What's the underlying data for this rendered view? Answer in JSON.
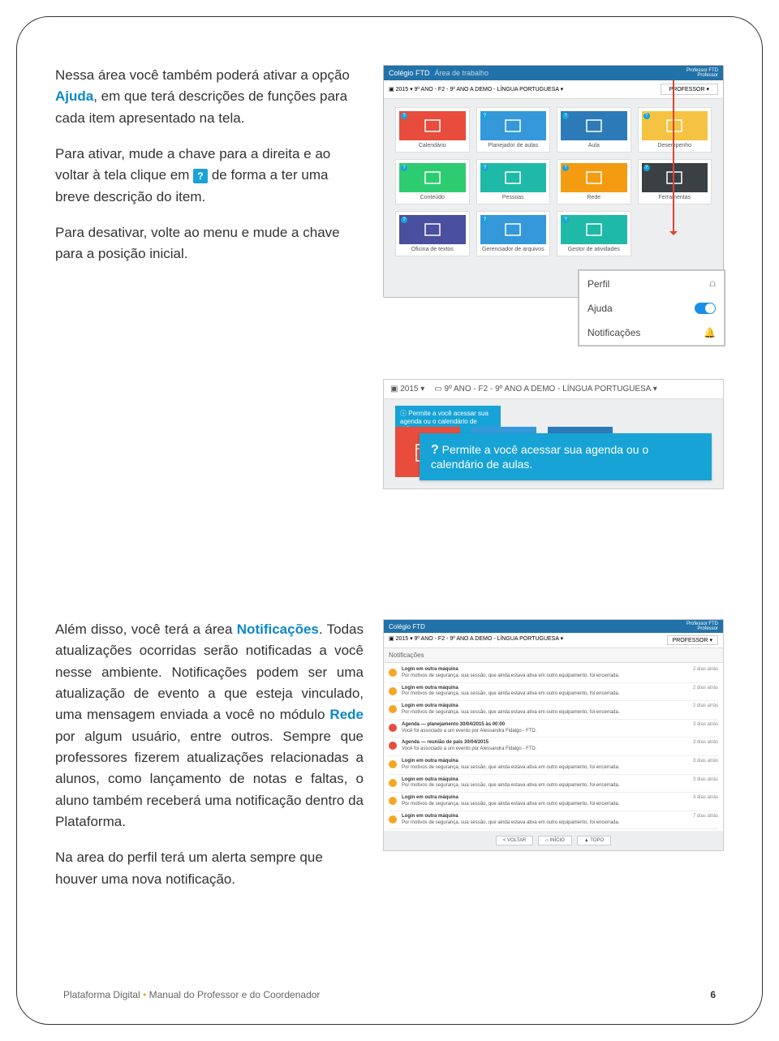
{
  "text": {
    "p1a": "Nessa área você também poderá ativar a opção ",
    "p1_link": "Ajuda",
    "p1b": ", em que terá descrições de funções para cada item apresentado na tela.",
    "p2a": "Para ativar, mude a chave para a direita e ao voltar à tela clique em ",
    "p2b": " de forma a ter uma breve descrição do item.",
    "p3": "Para desativar, volte ao menu e mude a chave para a posição inicial.",
    "p4a": "Além disso, você terá a área ",
    "p4_link": "Notificações",
    "p4b": ". Todas atualizações ocorridas serão notificadas a você nesse ambiente. Notificações podem ser uma atualização de evento a que esteja vinculado, uma mensagem enviada a você no módulo ",
    "p4_link2": "Rede",
    "p4c": " por algum usuário, entre outros. Sempre que professores fizerem atualizações relacionadas a alunos, como lançamento de notas e faltas, o aluno também receberá uma notificação dentro da Plataforma.",
    "p5": "Na area do perfil terá um alerta sempre que houver uma nova notificação."
  },
  "shot1": {
    "brand": "Colégio FTD",
    "area": "Área de trabalho",
    "breadcrumb": "2015  ▾   9º ANO - F2 - 9º ANO A DEMO - LÍNGUA PORTUGUESA ▾",
    "prof_name": "Professor FTD\nProfessor",
    "prof_btn": "PROFESSOR ▾",
    "tiles": [
      {
        "label": "Calendário",
        "color": "c-red"
      },
      {
        "label": "Planejador de aulas",
        "color": "c-blue"
      },
      {
        "label": "Aula",
        "color": "c-blue2"
      },
      {
        "label": "Desempenho",
        "color": "c-yellow"
      },
      {
        "label": "Conteúdo",
        "color": "c-green"
      },
      {
        "label": "Pessoas",
        "color": "c-teal"
      },
      {
        "label": "Rede",
        "color": "c-orange"
      },
      {
        "label": "Ferramentas",
        "color": "c-dark"
      },
      {
        "label": "Oficina de textos",
        "color": "c-indigo"
      },
      {
        "label": "Gerenciador de arquivos",
        "color": "c-blue"
      },
      {
        "label": "Gestor de atividades",
        "color": "c-teal"
      }
    ],
    "popup": {
      "perfil": "Perfil",
      "ajuda": "Ajuda",
      "notif": "Notificações"
    }
  },
  "shot2": {
    "year": "2015 ▾",
    "breadcrumb": "9º ANO - F2 - 9º ANO A DEMO - LÍNGUA PORTUGUESA ▾",
    "small_tip": "Permite a você acessar sua agenda ou o calendário de aulas.",
    "tooltip_q": "?",
    "tooltip": "Permite a você acessar sua agenda ou o calendário de aulas."
  },
  "shot3": {
    "brand": "Colégio FTD",
    "breadcrumb": "2015 ▾   9º ANO - F2 - 9º ANO A DEMO - LÍNGUA PORTUGUESA ▾",
    "prof_btn": "PROFESSOR ▾",
    "prof_name": "Professor FTD\nProfessor",
    "title": "Notificações",
    "rows": [
      {
        "c": "d-or",
        "t": "Login em outra máquina",
        "d": "Por motivos de segurança, sua sessão, que ainda estava ativa em outro equipamento, foi encerrada.",
        "tm": "2 dias atrás"
      },
      {
        "c": "d-or",
        "t": "Login em outra máquina",
        "d": "Por motivos de segurança, sua sessão, que ainda estava ativa em outro equipamento, foi encerrada.",
        "tm": "2 dias atrás"
      },
      {
        "c": "d-or",
        "t": "Login em outra máquina",
        "d": "Por motivos de segurança, sua sessão, que ainda estava ativa em outro equipamento, foi encerrada.",
        "tm": "2 dias atrás"
      },
      {
        "c": "d-rd",
        "t": "Agenda — planejamento 30/04/2015 às 00:00",
        "d": "Você foi associado a um evento por Alessandra Fidalgo - FTD.",
        "tm": "3 dias atrás"
      },
      {
        "c": "d-rd",
        "t": "Agenda — reunião de pais 30/04/2015",
        "d": "Você foi associado a um evento por Alessandra Fidalgo - FTD.",
        "tm": "3 dias atrás"
      },
      {
        "c": "d-or",
        "t": "Login em outra máquina",
        "d": "Por motivos de segurança, sua sessão, que ainda estava ativa em outro equipamento, foi encerrada.",
        "tm": "3 dias atrás"
      },
      {
        "c": "d-or",
        "t": "Login em outra máquina",
        "d": "Por motivos de segurança, sua sessão, que ainda estava ativa em outro equipamento, foi encerrada.",
        "tm": "3 dias atrás"
      },
      {
        "c": "d-or",
        "t": "Login em outra máquina",
        "d": "Por motivos de segurança, sua sessão, que ainda estava ativa em outro equipamento, foi encerrada.",
        "tm": "3 dias atrás"
      },
      {
        "c": "d-or",
        "t": "Login em outra máquina",
        "d": "Por motivos de segurança, sua sessão, que ainda estava ativa em outro equipamento, foi encerrada.",
        "tm": "7 dias atrás"
      }
    ],
    "btn_voltar": "< VOLTAR",
    "btn_inicio": "⌂ INÍCIO",
    "btn_topo": "▲ TOPO"
  },
  "footer": {
    "left_a": "Plataforma Digital",
    "left_b": "Manual do Professor e do Coordenador",
    "page": "6"
  },
  "icons": {
    "q": "?"
  }
}
